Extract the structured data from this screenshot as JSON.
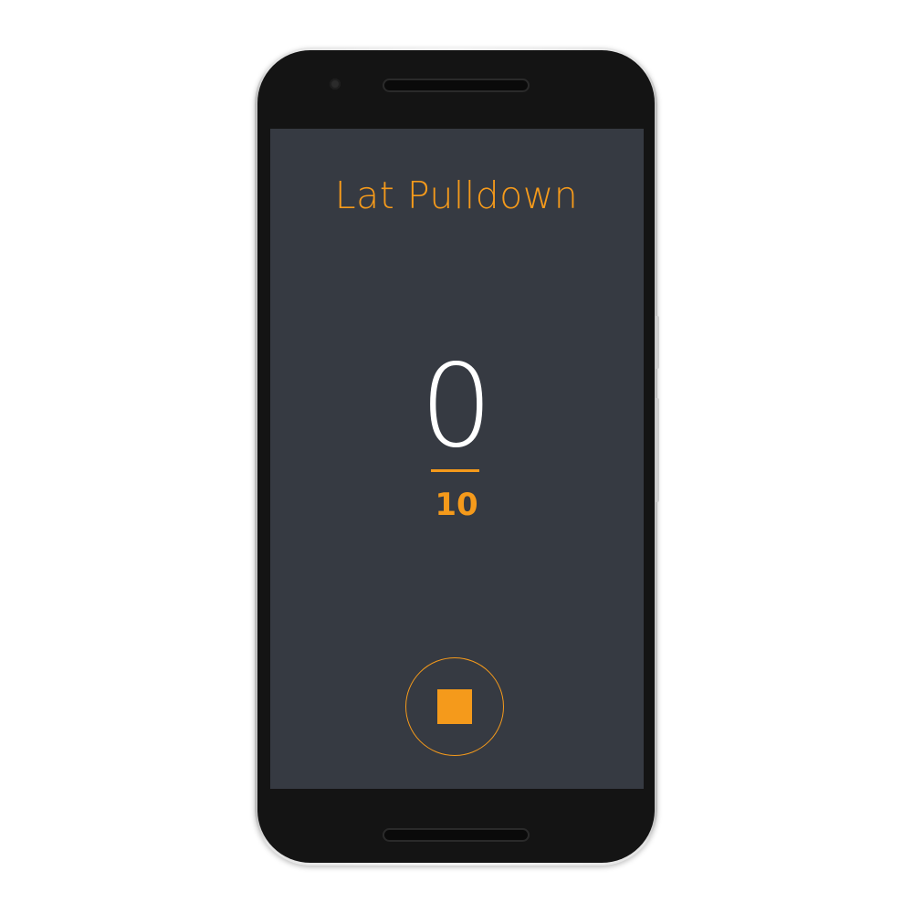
{
  "workout": {
    "exercise_name": "Lat Pulldown",
    "current_reps": "0",
    "target_reps": "10"
  },
  "controls": {
    "stop_icon": "stop-square-icon"
  },
  "colors": {
    "accent": "#f59a1b",
    "screen_background": "#363a42",
    "rep_count_text": "#ffffff"
  }
}
